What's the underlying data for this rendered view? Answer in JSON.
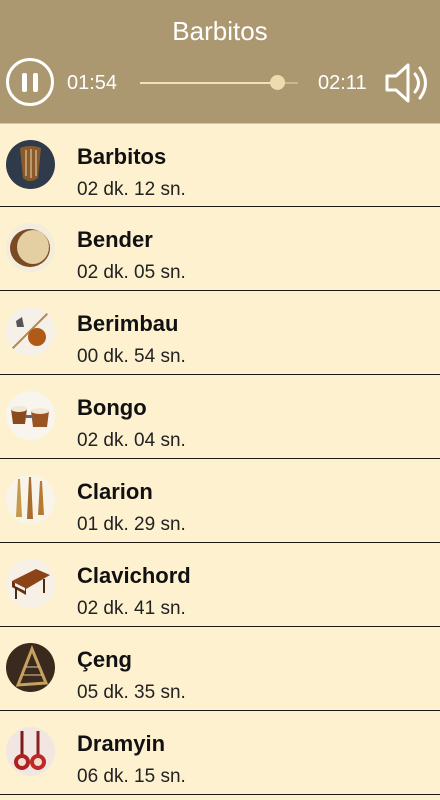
{
  "player": {
    "title": "Barbitos",
    "current_time": "01:54",
    "total_time": "02:11",
    "progress": 0.87
  },
  "colors": {
    "header_bg": "#ac9870",
    "list_bg": "#fdf1cf",
    "divider": "#1f1a14"
  },
  "icons": {
    "play_pause": "pause-icon",
    "volume": "speaker-icon"
  },
  "tracks": [
    {
      "name": "Barbitos",
      "duration": "02 dk. 12 sn.",
      "icon": "barbitos-thumbnail"
    },
    {
      "name": "Bender",
      "duration": "02 dk. 05 sn.",
      "icon": "bender-thumbnail"
    },
    {
      "name": "Berimbau",
      "duration": "00 dk. 54 sn.",
      "icon": "berimbau-thumbnail"
    },
    {
      "name": "Bongo",
      "duration": "02 dk. 04 sn.",
      "icon": "bongo-thumbnail"
    },
    {
      "name": "Clarion",
      "duration": "01 dk. 29 sn.",
      "icon": "clarion-thumbnail"
    },
    {
      "name": "Clavichord",
      "duration": "02 dk. 41 sn.",
      "icon": "clavichord-thumbnail"
    },
    {
      "name": "Çeng",
      "duration": "05 dk. 35 sn.",
      "icon": "ceng-thumbnail"
    },
    {
      "name": "Dramyin",
      "duration": "06 dk. 15 sn.",
      "icon": "dramyin-thumbnail"
    }
  ]
}
